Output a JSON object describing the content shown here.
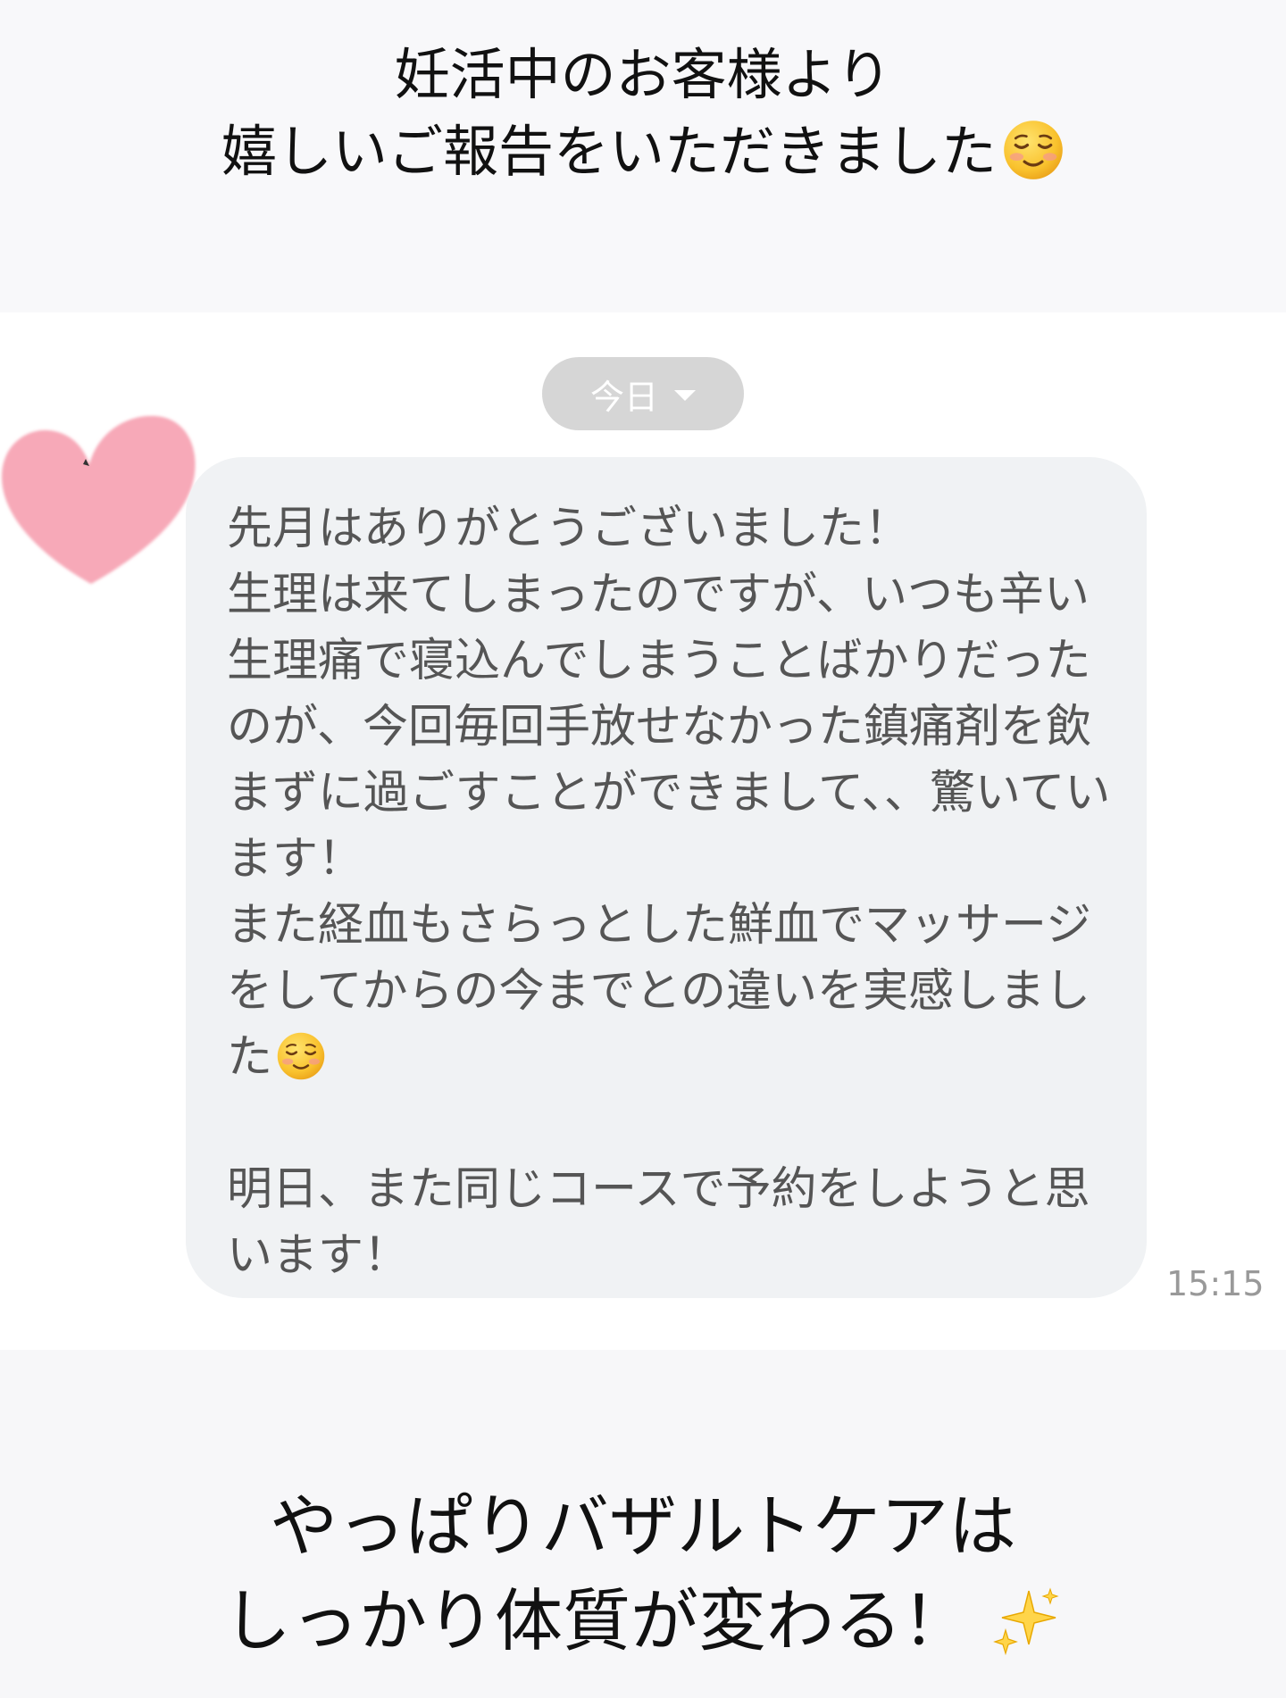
{
  "top_caption": {
    "line1": "妊活中のお客様より",
    "line2": "嬉しいご報告をいただきました",
    "line2_emoji": "relieved-smile-emoji"
  },
  "chat": {
    "date_pill": "今日",
    "date_pill_icon": "caret-down-icon",
    "sticker": "pink-heart",
    "message_part1": "先月はありがとうございました！\n生理は来てしまったのですが、いつも辛い生理痛で寝込んでしまうことばかりだったのが、今回毎回手放せなかった鎮痛剤を飲まずに過ごすことができまして、、驚いています！\nまた経血もさらっとした鮮血でマッサージをしてからの今までとの違いを実感しました",
    "message_emoji": "relieved-smile-emoji",
    "message_part2": "\n\n明日、また同じコースで予約をしようと思います！",
    "timestamp": "15:15"
  },
  "bottom_caption": {
    "line1": "やっぱりバザルトケアは",
    "line2": "しっかり体質が変わる！",
    "line2_emoji": "sparkles-emoji"
  },
  "colors": {
    "bubble": "#f0f2f4",
    "message_text": "#555555",
    "date_pill": "#d6d6d6",
    "heart": "#f7a9b8",
    "timestamp": "#999999"
  }
}
